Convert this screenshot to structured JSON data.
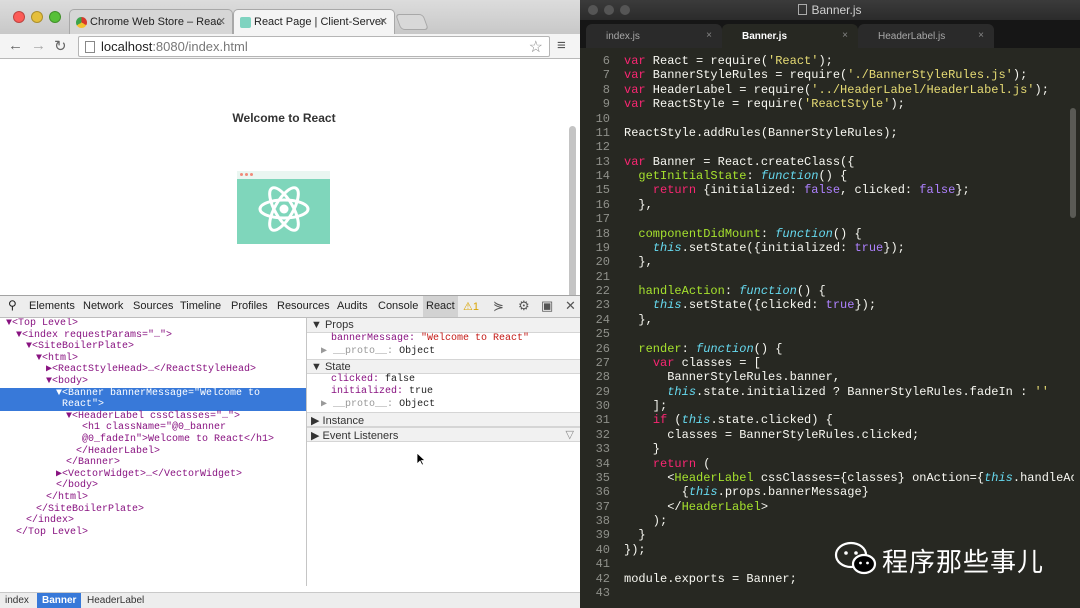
{
  "browser": {
    "tabs": [
      {
        "title": "Chrome Web Store – Reac"
      },
      {
        "title": "React Page | Client-Server"
      }
    ],
    "url": {
      "host": "localhost",
      "path": ":8080/index.html"
    },
    "page": {
      "heading": "Welcome to React"
    }
  },
  "devtools": {
    "tabs": [
      "Elements",
      "Network",
      "Sources",
      "Timeline",
      "Profiles",
      "Resources",
      "Audits",
      "Console",
      "React"
    ],
    "selected_tab": "React",
    "warning_count": "1",
    "tree": [
      {
        "indent": 0,
        "text": "▼<Top Level>"
      },
      {
        "indent": 1,
        "text": "▼<index requestParams=\"…\">"
      },
      {
        "indent": 2,
        "text": "▼<SiteBoilerPlate>"
      },
      {
        "indent": 3,
        "text": "▼<html>"
      },
      {
        "indent": 4,
        "text": "▶<ReactStyleHead>…</ReactStyleHead>"
      },
      {
        "indent": 4,
        "text": "▼<body>"
      },
      {
        "indent": 5,
        "text": "▼<Banner bannerMessage=\"Welcome to"
      },
      {
        "indent": 5,
        "text": " React\">"
      },
      {
        "indent": 6,
        "text": "▼<HeaderLabel cssClasses=\"…\">"
      },
      {
        "indent": 7,
        "text": " <h1 className=\"@0_banner"
      },
      {
        "indent": 7,
        "text": " @0_fadeIn\">Welcome to React</h1>"
      },
      {
        "indent": 7,
        "text": "</HeaderLabel>"
      },
      {
        "indent": 6,
        "text": "</Banner>"
      },
      {
        "indent": 5,
        "text": "▶<VectorWidget>…</VectorWidget>"
      },
      {
        "indent": 5,
        "text": "</body>"
      },
      {
        "indent": 4,
        "text": "</html>"
      },
      {
        "indent": 3,
        "text": "</SiteBoilerPlate>"
      },
      {
        "indent": 2,
        "text": "</index>"
      },
      {
        "indent": 1,
        "text": "</Top Level>"
      }
    ],
    "sidebar": {
      "props_label": "Props",
      "props": [
        {
          "key": "bannerMessage",
          "value": "\"Welcome to React\""
        },
        {
          "key": "__proto__",
          "value": "Object"
        }
      ],
      "state_label": "State",
      "state": [
        {
          "key": "clicked",
          "value": "false"
        },
        {
          "key": "initialized",
          "value": "true"
        },
        {
          "key": "__proto__",
          "value": "Object"
        }
      ],
      "instance_label": "Instance",
      "listeners_label": "Event Listeners"
    },
    "breadcrumbs": [
      "index",
      "Banner",
      "HeaderLabel"
    ],
    "selected_crumb": "Banner"
  },
  "editor": {
    "window_title": "Banner.js",
    "tabs": [
      "index.js",
      "Banner.js",
      "HeaderLabel.js"
    ],
    "active_tab": "Banner.js",
    "first_line_number": 6,
    "lines": [
      "var React = require('React');",
      "var BannerStyleRules = require('./BannerStyleRules.js');",
      "var HeaderLabel = require('../HeaderLabel/HeaderLabel.js');",
      "var ReactStyle = require('ReactStyle');",
      "",
      "ReactStyle.addRules(BannerStyleRules);",
      "",
      "var Banner = React.createClass({",
      "  getInitialState: function() {",
      "    return {initialized: false, clicked: false};",
      "  },",
      "",
      "  componentDidMount: function() {",
      "    this.setState({initialized: true});",
      "  },",
      "",
      "  handleAction: function() {",
      "    this.setState({clicked: true});",
      "  },",
      "",
      "  render: function() {",
      "    var classes = [",
      "      BannerStyleRules.banner,",
      "      this.state.initialized ? BannerStyleRules.fadeIn : ''",
      "    ];",
      "    if (this.state.clicked) {",
      "      classes = BannerStyleRules.clicked;",
      "    }",
      "    return (",
      "      <HeaderLabel cssClasses={classes} onAction={this.handleActi",
      "        {this.props.bannerMessage}",
      "      </HeaderLabel>",
      "    );",
      "  }",
      "});",
      "",
      "module.exports = Banner;",
      ""
    ]
  },
  "watermark": {
    "text": "程序那些事儿"
  }
}
